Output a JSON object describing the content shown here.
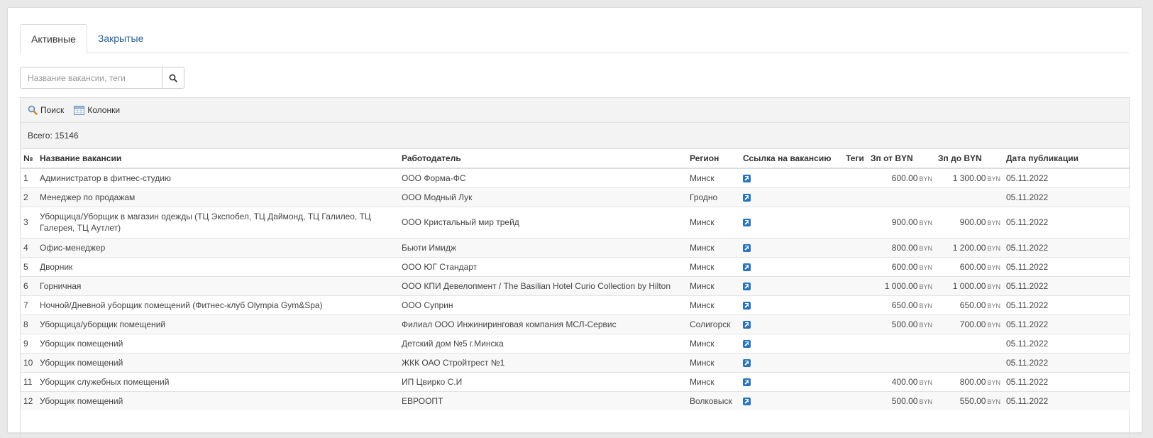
{
  "tabs": [
    {
      "label": "Активные"
    },
    {
      "label": "Закрытые"
    }
  ],
  "search": {
    "placeholder": "Название вакансии, теги"
  },
  "toolbar": {
    "search_label": "Поиск",
    "columns_label": "Колонки"
  },
  "total": "Всего: 15146",
  "columns": [
    "№",
    "Название вакансии",
    "Работодатель",
    "Регион",
    "Ссылка на вакансию",
    "Теги",
    "Зп от BYN",
    "Зп до BYN",
    "Дата публикации"
  ],
  "currency": "BYN",
  "rows": [
    {
      "n": "1",
      "title": "Администратор в фитнес-студию",
      "employer": "ООО Форма-ФС",
      "region": "Минск",
      "tags": "",
      "from": "600.00",
      "to": "1 300.00",
      "date": "05.11.2022"
    },
    {
      "n": "2",
      "title": "Менеджер по продажам",
      "employer": "ООО Модный Лук",
      "region": "Гродно",
      "tags": "",
      "from": "",
      "to": "",
      "date": "05.11.2022"
    },
    {
      "n": "3",
      "title": "Уборщица/Уборщик в магазин одежды (ТЦ Экспобел, ТЦ Даймонд, ТЦ Галилео, ТЦ Галерея, ТЦ Аутлет)",
      "employer": "ООО Кристальный мир трейд",
      "region": "Минск",
      "tags": "",
      "from": "900.00",
      "to": "900.00",
      "date": "05.11.2022"
    },
    {
      "n": "4",
      "title": "Офис-менеджер",
      "employer": "Бьюти Имидж",
      "region": "Минск",
      "tags": "",
      "from": "800.00",
      "to": "1 200.00",
      "date": "05.11.2022"
    },
    {
      "n": "5",
      "title": "Дворник",
      "employer": "ООО ЮГ Стандарт",
      "region": "Минск",
      "tags": "",
      "from": "600.00",
      "to": "600.00",
      "date": "05.11.2022"
    },
    {
      "n": "6",
      "title": "Горничная",
      "employer": "ООО КПИ Девелопмент / The Basilian Hotel Curio Collection by Hilton",
      "region": "Минск",
      "tags": "",
      "from": "1 000.00",
      "to": "1 000.00",
      "date": "05.11.2022"
    },
    {
      "n": "7",
      "title": "Ночной/Дневной уборщик помещений (Фитнес-клуб Olympia Gym&Spa)",
      "employer": "ООО Суприн",
      "region": "Минск",
      "tags": "",
      "from": "650.00",
      "to": "650.00",
      "date": "05.11.2022"
    },
    {
      "n": "8",
      "title": "Уборщица/уборщик помещений",
      "employer": "Филиал ООО Инжиниринговая компания МСЛ-Сервис",
      "region": "Солигорск",
      "tags": "",
      "from": "500.00",
      "to": "700.00",
      "date": "05.11.2022"
    },
    {
      "n": "9",
      "title": "Уборщик помещений",
      "employer": "Детский дом №5 г.Минска",
      "region": "Минск",
      "tags": "",
      "from": "",
      "to": "",
      "date": "05.11.2022"
    },
    {
      "n": "10",
      "title": "Уборщик помещений",
      "employer": "ЖКК ОАО Стройтрест №1",
      "region": "Минск",
      "tags": "",
      "from": "",
      "to": "",
      "date": "05.11.2022"
    },
    {
      "n": "11",
      "title": "Уборщик служебных помещений",
      "employer": "ИП Цвирко С.И",
      "region": "Минск",
      "tags": "",
      "from": "400.00",
      "to": "800.00",
      "date": "05.11.2022"
    },
    {
      "n": "12",
      "title": "Уборщик помещений",
      "employer": "ЕВРООПТ",
      "region": "Волковыск",
      "tags": "",
      "from": "500.00",
      "to": "550.00",
      "date": "05.11.2022"
    }
  ]
}
